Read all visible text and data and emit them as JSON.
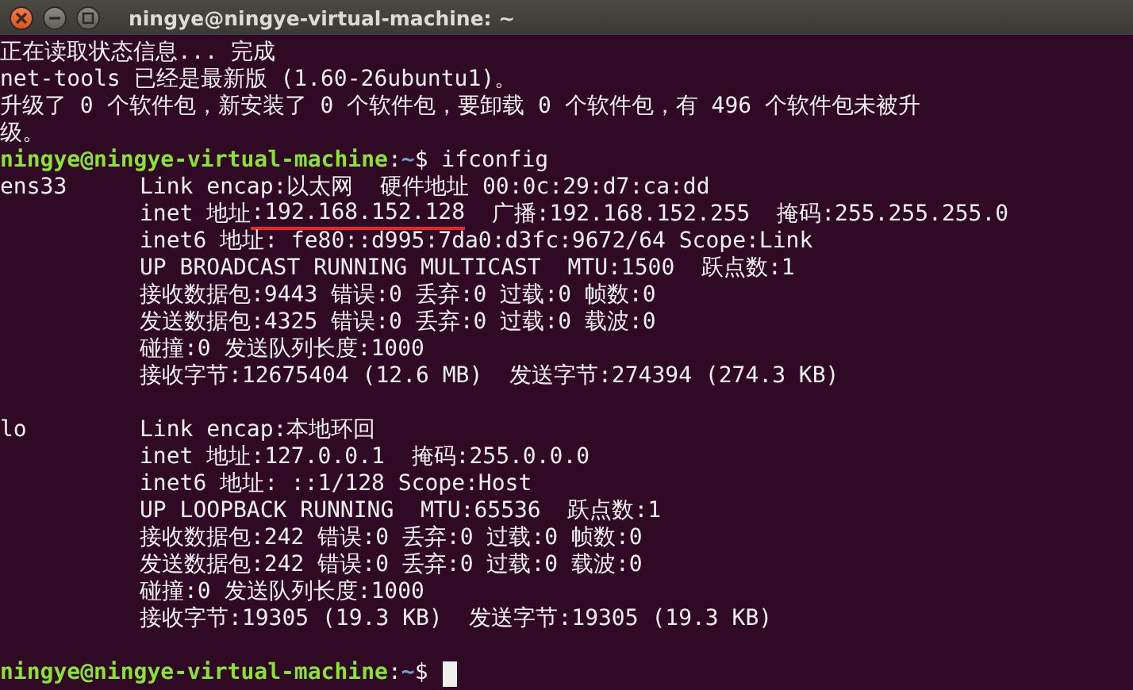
{
  "window": {
    "title": "ningye@ningye-virtual-machine: ~"
  },
  "lines": [
    {
      "kind": "text",
      "text": "正在读取状态信息... 完成"
    },
    {
      "kind": "text",
      "text": "net-tools 已经是最新版 (1.60-26ubuntu1)。"
    },
    {
      "kind": "text",
      "text": "升级了 0 个软件包，新安装了 0 个软件包，要卸载 0 个软件包，有 496 个软件包未被升"
    },
    {
      "kind": "text",
      "text": "级。"
    },
    {
      "kind": "prompt",
      "user": "ningye@ningye-virtual-machine",
      "separator": ":",
      "path": "~",
      "symbol": "$",
      "command": "ifconfig",
      "cursor": false
    },
    {
      "kind": "iface",
      "name": "ens33",
      "segments": [
        {
          "text": "Link encap:以太网  硬件地址 00:0c:29:d7:ca:dd",
          "underlined": false
        }
      ]
    },
    {
      "kind": "detail",
      "segments": [
        {
          "text": "inet 地址",
          "underlined": false
        },
        {
          "text": ":192.168.152.128",
          "underlined": true
        },
        {
          "text": "  广播:192.168.152.255  掩码:255.255.255.0",
          "underlined": false
        }
      ]
    },
    {
      "kind": "detail",
      "segments": [
        {
          "text": "inet6 地址: fe80::d995:7da0:d3fc:9672/64 Scope:Link",
          "underlined": false
        }
      ]
    },
    {
      "kind": "detail",
      "segments": [
        {
          "text": "UP BROADCAST RUNNING MULTICAST  MTU:1500  跃点数:1",
          "underlined": false
        }
      ]
    },
    {
      "kind": "detail",
      "segments": [
        {
          "text": "接收数据包:9443 错误:0 丢弃:0 过载:0 帧数:0",
          "underlined": false
        }
      ]
    },
    {
      "kind": "detail",
      "segments": [
        {
          "text": "发送数据包:4325 错误:0 丢弃:0 过载:0 载波:0",
          "underlined": false
        }
      ]
    },
    {
      "kind": "detail",
      "segments": [
        {
          "text": "碰撞:0 发送队列长度:1000",
          "underlined": false
        }
      ]
    },
    {
      "kind": "detail",
      "segments": [
        {
          "text": "接收字节:12675404 (12.6 MB)  发送字节:274394 (274.3 KB)",
          "underlined": false
        }
      ]
    },
    {
      "kind": "blank"
    },
    {
      "kind": "iface",
      "name": "lo",
      "segments": [
        {
          "text": "Link encap:本地环回",
          "underlined": false
        }
      ]
    },
    {
      "kind": "detail",
      "segments": [
        {
          "text": "inet 地址:127.0.0.1  掩码:255.0.0.0",
          "underlined": false
        }
      ]
    },
    {
      "kind": "detail",
      "segments": [
        {
          "text": "inet6 地址: ::1/128 Scope:Host",
          "underlined": false
        }
      ]
    },
    {
      "kind": "detail",
      "segments": [
        {
          "text": "UP LOOPBACK RUNNING  MTU:65536  跃点数:1",
          "underlined": false
        }
      ]
    },
    {
      "kind": "detail",
      "segments": [
        {
          "text": "接收数据包:242 错误:0 丢弃:0 过载:0 帧数:0",
          "underlined": false
        }
      ]
    },
    {
      "kind": "detail",
      "segments": [
        {
          "text": "发送数据包:242 错误:0 丢弃:0 过载:0 载波:0",
          "underlined": false
        }
      ]
    },
    {
      "kind": "detail",
      "segments": [
        {
          "text": "碰撞:0 发送队列长度:1000",
          "underlined": false
        }
      ]
    },
    {
      "kind": "detail",
      "segments": [
        {
          "text": "接收字节:19305 (19.3 KB)  发送字节:19305 (19.3 KB)",
          "underlined": false
        }
      ]
    },
    {
      "kind": "blank"
    },
    {
      "kind": "prompt",
      "user": "ningye@ningye-virtual-machine",
      "separator": ":",
      "path": "~",
      "symbol": "$",
      "cursor": true
    }
  ]
}
